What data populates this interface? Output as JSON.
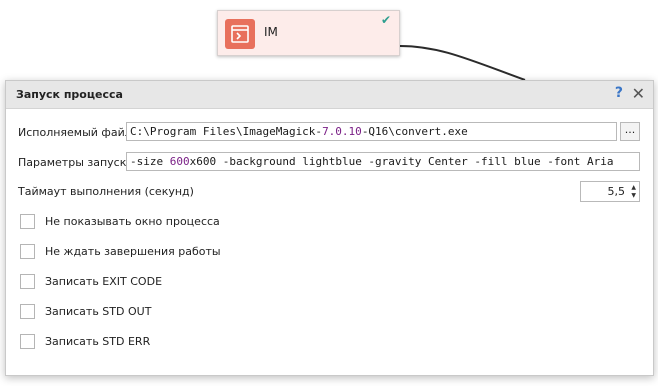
{
  "node": {
    "label": "IM",
    "status": "ok",
    "colors": {
      "icon_bg": "#e8705c",
      "node_bg": "#fdecea",
      "status": "#2e9e8f"
    }
  },
  "dialog": {
    "title": "Запуск процесса",
    "help_symbol": "?",
    "close_symbol": "✕",
    "executable": {
      "label": "Исполняемый файл",
      "value_parts": [
        "C:\\Program Files\\ImageMagick-",
        "7.0.10",
        "-Q16\\convert.exe"
      ],
      "browse_label": "..."
    },
    "params": {
      "label": "Параметры запуска",
      "value_parts": [
        "-size ",
        "600",
        "x600 -background lightblue -gravity Center -fill blue -font Aria"
      ]
    },
    "timeout": {
      "label": "Таймаут выполнения (секунд)",
      "value": "5,5"
    },
    "checkboxes": [
      {
        "label": "Не показывать окно процесса",
        "checked": false
      },
      {
        "label": "Не ждать завершения работы",
        "checked": false
      },
      {
        "label": "Записать EXIT CODE",
        "checked": false
      },
      {
        "label": "Записать STD OUT",
        "checked": false
      },
      {
        "label": "Записать STD ERR",
        "checked": false
      }
    ]
  }
}
